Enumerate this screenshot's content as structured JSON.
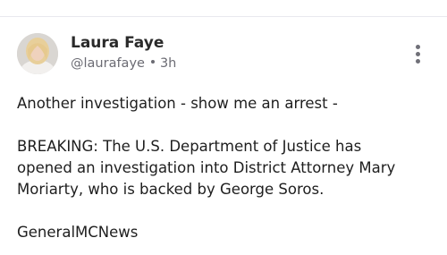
{
  "post": {
    "author": {
      "name": "Laura Faye",
      "handle": "@laurafaye",
      "time": "3h",
      "avatar": "avatar-photo"
    },
    "more_icon": "vertical-ellipsis-icon",
    "paragraphs": [
      "Another investigation - show me an arrest -",
      "BREAKING: The U.S. Department of Justice has\nopened an investigation into District Attorney Mary\nMoriarty, who is backed by George Soros.",
      "GeneralMCNews"
    ]
  },
  "colors": {
    "divider": "#e9e9ee",
    "name": "#2a2a2a",
    "meta": "#6b6b73",
    "body": "#1e1e1e"
  }
}
